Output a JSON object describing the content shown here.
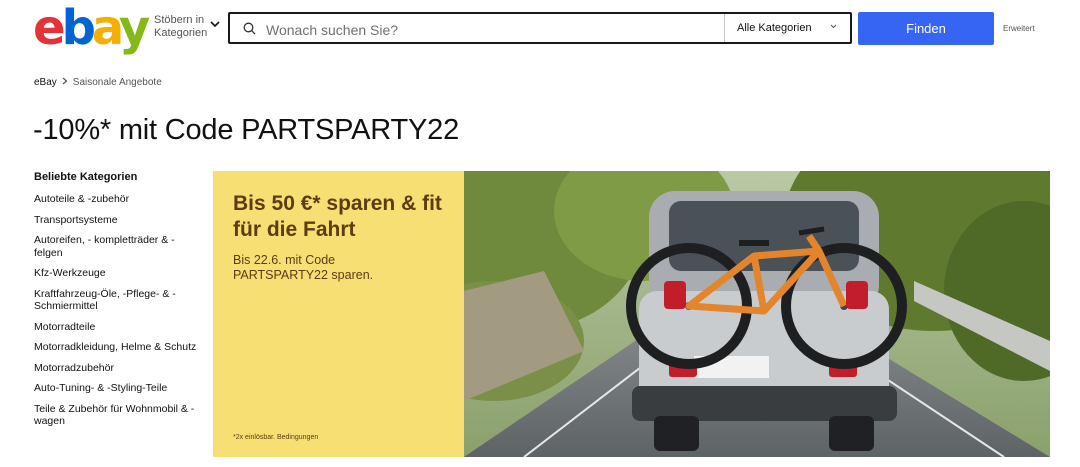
{
  "header": {
    "logo": {
      "e": "e",
      "b": "b",
      "a": "a",
      "y": "y"
    },
    "shop_by": {
      "line1": "Stöbern in",
      "line2": "Kategorien"
    },
    "search": {
      "placeholder": "Wonach suchen Sie?",
      "value": ""
    },
    "category_select": "Alle Kategorien",
    "find_label": "Finden",
    "advanced_label": "Erweitert"
  },
  "breadcrumb": {
    "home": "eBay",
    "current": "Saisonale Angebote"
  },
  "page_title": "-10%* mit Code PARTSPARTY22",
  "sidebar": {
    "heading": "Beliebte Kategorien",
    "items": [
      "Autoteile & -zubehör",
      "Transportsysteme",
      "Autoreifen, - kompletträder & - felgen",
      "Kfz-Werkzeuge",
      "Kraftfahrzeug-Öle, -Pflege- & - Schmiermittel",
      "Motorradteile",
      "Motorradkleidung, Helme & Schutz",
      "Motorradzubehör",
      "Auto-Tuning- & -Styling-Teile",
      "Teile & Zubehör für Wohnmobil & -wagen"
    ]
  },
  "banner": {
    "headline": "Bis 50 €* sparen & fit für die Fahrt",
    "sub": "Bis 22.6. mit Code PARTSPARTY22 sparen.",
    "footnote": "*2x einlösbar. Bedingungen"
  },
  "colors": {
    "find_button": "#3665f3",
    "banner_yellow": "#f7df74",
    "banner_text": "#5b3d11"
  },
  "icons": [
    "search-icon",
    "chevron-down-icon",
    "breadcrumb-chevron-icon"
  ]
}
